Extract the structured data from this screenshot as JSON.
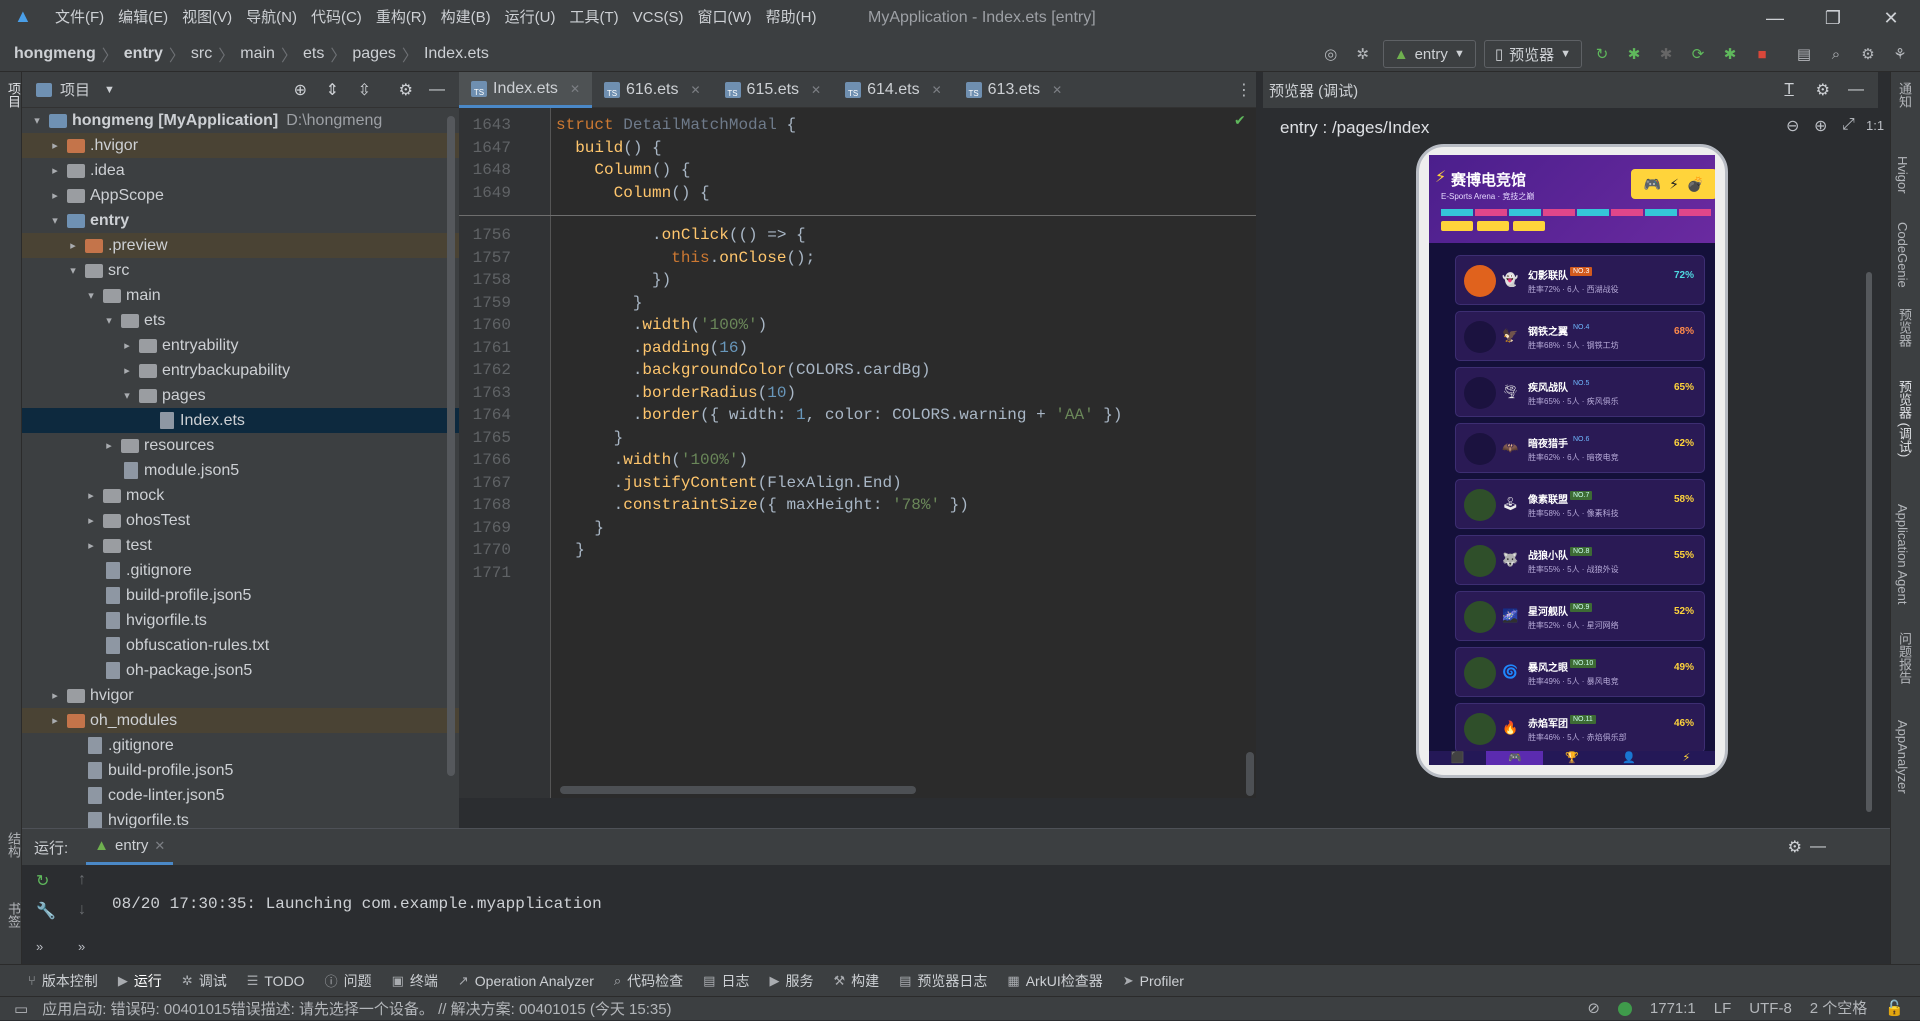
{
  "menu": [
    "文件(F)",
    "编辑(E)",
    "视图(V)",
    "导航(N)",
    "代码(C)",
    "重构(R)",
    "构建(B)",
    "运行(U)",
    "工具(T)",
    "VCS(S)",
    "窗口(W)",
    "帮助(H)"
  ],
  "window_title": "MyApplication - Index.ets [entry]",
  "window_controls": [
    "minimize-icon",
    "restore-icon",
    "close-icon"
  ],
  "breadcrumb": [
    "hongmeng",
    "entry",
    "src",
    "main",
    "ets",
    "pages",
    "Index.ets"
  ],
  "toolbar": {
    "module": "entry",
    "previewer": "预览器"
  },
  "project_panel": {
    "title": "项目",
    "rows": [
      {
        "indent": 0,
        "arrow": "▾",
        "icon": "folder",
        "color": "blue",
        "label": "hongmeng [MyApplication]",
        "extra": "D:\\hongmeng",
        "bold": true
      },
      {
        "indent": 1,
        "arrow": "▸",
        "icon": "folder",
        "color": "orange",
        "label": ".hvigor",
        "hl": true
      },
      {
        "indent": 1,
        "arrow": "▸",
        "icon": "folder",
        "color": "grey",
        "label": ".idea"
      },
      {
        "indent": 1,
        "arrow": "▸",
        "icon": "folder",
        "color": "grey",
        "label": "AppScope"
      },
      {
        "indent": 1,
        "arrow": "▾",
        "icon": "folder",
        "color": "blue",
        "label": "entry",
        "bold": true
      },
      {
        "indent": 2,
        "arrow": "▸",
        "icon": "folder",
        "color": "orange",
        "label": ".preview",
        "hl": true
      },
      {
        "indent": 2,
        "arrow": "▾",
        "icon": "folder",
        "color": "grey",
        "label": "src"
      },
      {
        "indent": 3,
        "arrow": "▾",
        "icon": "folder",
        "color": "grey",
        "label": "main"
      },
      {
        "indent": 4,
        "arrow": "▾",
        "icon": "folder",
        "color": "grey",
        "label": "ets"
      },
      {
        "indent": 5,
        "arrow": "▸",
        "icon": "folder",
        "color": "grey",
        "label": "entryability"
      },
      {
        "indent": 5,
        "arrow": "▸",
        "icon": "folder",
        "color": "grey",
        "label": "entrybackupability"
      },
      {
        "indent": 5,
        "arrow": "▾",
        "icon": "folder",
        "color": "grey",
        "label": "pages"
      },
      {
        "indent": 6,
        "arrow": "",
        "icon": "file",
        "label": "Index.ets",
        "selected": true
      },
      {
        "indent": 4,
        "arrow": "▸",
        "icon": "folder",
        "color": "grey",
        "label": "resources"
      },
      {
        "indent": 4,
        "arrow": "",
        "icon": "file",
        "label": "module.json5"
      },
      {
        "indent": 3,
        "arrow": "▸",
        "icon": "folder",
        "color": "grey",
        "label": "mock"
      },
      {
        "indent": 3,
        "arrow": "▸",
        "icon": "folder",
        "color": "grey",
        "label": "ohosTest"
      },
      {
        "indent": 3,
        "arrow": "▸",
        "icon": "folder",
        "color": "grey",
        "label": "test"
      },
      {
        "indent": 3,
        "arrow": "",
        "icon": "file",
        "label": ".gitignore"
      },
      {
        "indent": 3,
        "arrow": "",
        "icon": "file",
        "label": "build-profile.json5"
      },
      {
        "indent": 3,
        "arrow": "",
        "icon": "file",
        "label": "hvigorfile.ts"
      },
      {
        "indent": 3,
        "arrow": "",
        "icon": "file",
        "label": "obfuscation-rules.txt"
      },
      {
        "indent": 3,
        "arrow": "",
        "icon": "file",
        "label": "oh-package.json5"
      },
      {
        "indent": 1,
        "arrow": "▸",
        "icon": "folder",
        "color": "grey",
        "label": "hvigor"
      },
      {
        "indent": 1,
        "arrow": "▸",
        "icon": "folder",
        "color": "orange",
        "label": "oh_modules",
        "hl": true
      },
      {
        "indent": 2,
        "arrow": "",
        "icon": "file",
        "label": ".gitignore"
      },
      {
        "indent": 2,
        "arrow": "",
        "icon": "file",
        "label": "build-profile.json5"
      },
      {
        "indent": 2,
        "arrow": "",
        "icon": "file",
        "label": "code-linter.json5"
      },
      {
        "indent": 2,
        "arrow": "",
        "icon": "file",
        "label": "hvigorfile.ts"
      }
    ]
  },
  "editor_tabs": [
    {
      "label": "Index.ets",
      "active": true
    },
    {
      "label": "616.ets"
    },
    {
      "label": "615.ets"
    },
    {
      "label": "614.ets"
    },
    {
      "label": "613.ets"
    }
  ],
  "code_lines": [
    {
      "n": "1643",
      "html": "<span class='kw'>struct</span> <span class='cls' style='color:#6e7a8a'>DetailMatchModal</span> {"
    },
    {
      "n": "1647",
      "html": "  <span class='fn'>build</span>() {"
    },
    {
      "n": "1648",
      "html": "    <span class='fn'>Column</span>() {"
    },
    {
      "n": "1649",
      "html": "      <span class='fn'>Column</span>() {"
    },
    {
      "n": "1756",
      "html": "          .<span class='fn'>onClick</span>(() => {"
    },
    {
      "n": "1757",
      "html": "            <span class='kw'>this</span>.<span class='fn'>onClose</span>();"
    },
    {
      "n": "1758",
      "html": "          })"
    },
    {
      "n": "1759",
      "html": "        }"
    },
    {
      "n": "1760",
      "html": "        .<span class='fn'>width</span>(<span class='str'>'100%'</span>)"
    },
    {
      "n": "1761",
      "html": "        .<span class='fn'>padding</span>(<span class='num'>16</span>)"
    },
    {
      "n": "1762",
      "html": "        .<span class='fn'>backgroundColor</span>(COLORS.cardBg)"
    },
    {
      "n": "1763",
      "html": "        .<span class='fn'>borderRadius</span>(<span class='num'>10</span>)"
    },
    {
      "n": "1764",
      "html": "        .<span class='fn'>border</span>({ width: <span class='num'>1</span>, color: COLORS.warning + <span class='str'>'AA'</span> })"
    },
    {
      "n": "1765",
      "html": "      }"
    },
    {
      "n": "1766",
      "html": "      .<span class='fn'>width</span>(<span class='str'>'100%'</span>)"
    },
    {
      "n": "1767",
      "html": "      .<span class='fn'>justifyContent</span>(FlexAlign.End)"
    },
    {
      "n": "1768",
      "html": "      .<span class='fn'>constraintSize</span>({ maxHeight: <span class='str'>'78%'</span> })"
    },
    {
      "n": "1769",
      "html": "    }"
    },
    {
      "n": "1770",
      "html": "  }"
    },
    {
      "n": "1771",
      "html": ""
    }
  ],
  "preview": {
    "header": "预览器 (调试)",
    "path": "entry : /pages/Index",
    "app_title": "赛博电竞馆",
    "app_sub": "E-Sports Arena · 竞技之巅",
    "stripe_colors": [
      "#35c6d8",
      "#e0468a",
      "#35c6d8",
      "#e0468a",
      "#35c6d8",
      "#e0468a",
      "#35c6d8",
      "#e0468a"
    ],
    "teams": [
      {
        "name": "幻影联队",
        "rank": "NO.3",
        "rank_style": "orange",
        "meta": "胜率72% · 6人 · 西湖战役",
        "pct": "72%",
        "pct_color": "#4fd8e0",
        "av": "#e0621d",
        "icon": "👻"
      },
      {
        "name": "钢铁之翼",
        "rank": "NO.4",
        "rank_style": "blue",
        "meta": "胜率68% · 5人 · 钢铁工坊",
        "pct": "68%",
        "pct_color": "#ff8a4a",
        "av": "#1b123f",
        "icon": "🦅"
      },
      {
        "name": "疾风战队",
        "rank": "NO.5",
        "rank_style": "blue",
        "meta": "胜率65% · 5人 · 疾风俱乐",
        "pct": "65%",
        "pct_color": "#ffd43b",
        "av": "#1b123f",
        "icon": "🌪"
      },
      {
        "name": "暗夜猎手",
        "rank": "NO.6",
        "rank_style": "blue",
        "meta": "胜率62% · 6人 · 暗夜电竞",
        "pct": "62%",
        "pct_color": "#ffd43b",
        "av": "#1b123f",
        "icon": "🦇"
      },
      {
        "name": "像素联盟",
        "rank": "NO.7",
        "rank_style": "green",
        "meta": "胜率58% · 5人 · 像素科技",
        "pct": "58%",
        "pct_color": "#ffd43b",
        "av": "#2f4f2a",
        "icon": "🕹"
      },
      {
        "name": "战狼小队",
        "rank": "NO.8",
        "rank_style": "green",
        "meta": "胜率55% · 5人 · 战狼外设",
        "pct": "55%",
        "pct_color": "#ffd43b",
        "av": "#2f4f2a",
        "icon": "🐺"
      },
      {
        "name": "星河舰队",
        "rank": "NO.9",
        "rank_style": "green",
        "meta": "胜率52% · 6人 · 星河网络",
        "pct": "52%",
        "pct_color": "#ffd43b",
        "av": "#2f4f2a",
        "icon": "🌌"
      },
      {
        "name": "暴风之眼",
        "rank": "NO.10",
        "rank_style": "green",
        "meta": "胜率49% · 5人 · 暴风电竞",
        "pct": "49%",
        "pct_color": "#ffd43b",
        "av": "#2f4f2a",
        "icon": "🌀"
      },
      {
        "name": "赤焰军团",
        "rank": "NO.11",
        "rank_style": "green",
        "meta": "胜率46% · 5人 · 赤焰俱乐部",
        "pct": "46%",
        "pct_color": "#ffd43b",
        "av": "#2f4f2a",
        "icon": "🔥"
      }
    ],
    "tab_icons": [
      "⬛",
      "🎮",
      "🏆",
      "👤",
      "⚡"
    ]
  },
  "right_strip": [
    "通知",
    "Hvigor",
    "CodeGenie",
    "预览器",
    "预览器 (调试)",
    "Application Agent",
    "问题报告",
    "AppAnalyzer"
  ],
  "run_panel": {
    "label": "运行:",
    "tab": "entry",
    "log": "08/20 17:30:35: Launching com.example.myapplication"
  },
  "bottom_tools": [
    "版本控制",
    "运行",
    "调试",
    "TODO",
    "问题",
    "终端",
    "Operation Analyzer",
    "代码检查",
    "日志",
    "服务",
    "构建",
    "预览器日志",
    "ArkUI检查器",
    "Profiler"
  ],
  "status": {
    "message": "应用启动: 错误码: 00401015错误描述: 请先选择一个设备。 // 解决方案: 00401015 (今天 15:35)",
    "position": "1771:1",
    "line_sep": "LF",
    "encoding": "UTF-8",
    "indent": "2 个空格"
  }
}
